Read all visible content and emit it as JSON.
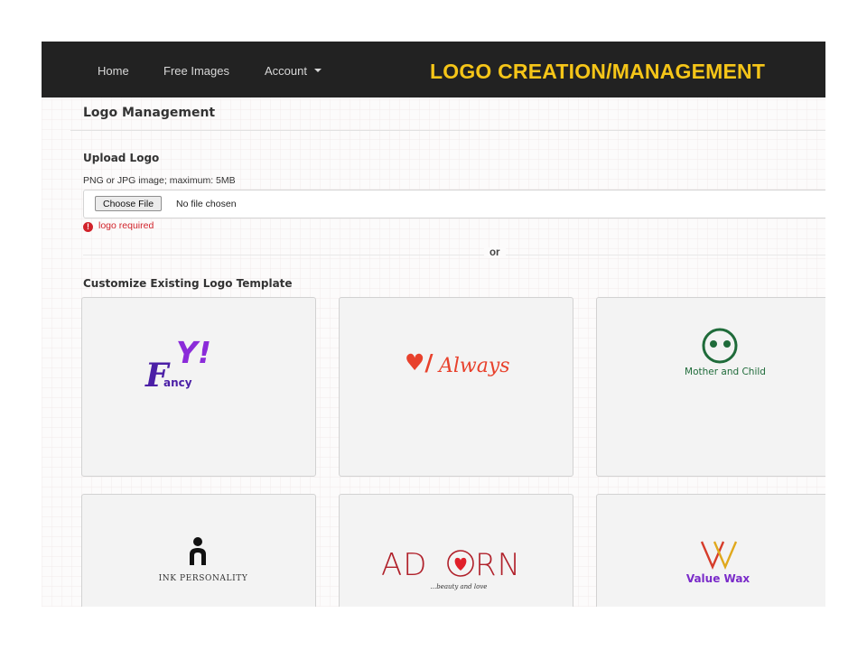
{
  "nav": {
    "items": [
      {
        "label": "Home"
      },
      {
        "label": "Free Images"
      },
      {
        "label": "Account"
      }
    ]
  },
  "banner": "LOGO CREATION/MANAGEMENT",
  "page": {
    "title": "Logo Management",
    "upload": {
      "heading": "Upload Logo",
      "hint": "PNG or JPG image; maximum: 5MB",
      "choose_label": "Choose File",
      "no_file_text": "No file chosen",
      "error": "logo required"
    },
    "or_text": "or",
    "templates_heading": "Customize Existing Logo Template",
    "templates": [
      {
        "name": "Fancy",
        "mark": "Y!",
        "initial": "F",
        "word": "ancy",
        "colors": {
          "primary": "#4b1fa6",
          "accent": "#8b2bd9"
        }
      },
      {
        "name": "Always",
        "mark": "♥/",
        "word": "Always",
        "colors": {
          "primary": "#e8412c"
        }
      },
      {
        "name": "Mother and Child",
        "text": "Mother and Child",
        "colors": {
          "primary": "#1f6b3a"
        }
      },
      {
        "name": "Ink Personality",
        "text": "INK PERSONALITY",
        "colors": {
          "primary": "#222222"
        }
      },
      {
        "name": "Adorn",
        "pre": "AD",
        "post": "RN",
        "tagline": "...beauty and love",
        "colors": {
          "primary": "#b0202a",
          "heart": "#e0202a"
        }
      },
      {
        "name": "Value Wax",
        "text": "Value Wax",
        "colors": {
          "primary": "#7a2bc9",
          "w1": "#d63c2a",
          "w2": "#e0a81c"
        }
      }
    ]
  }
}
